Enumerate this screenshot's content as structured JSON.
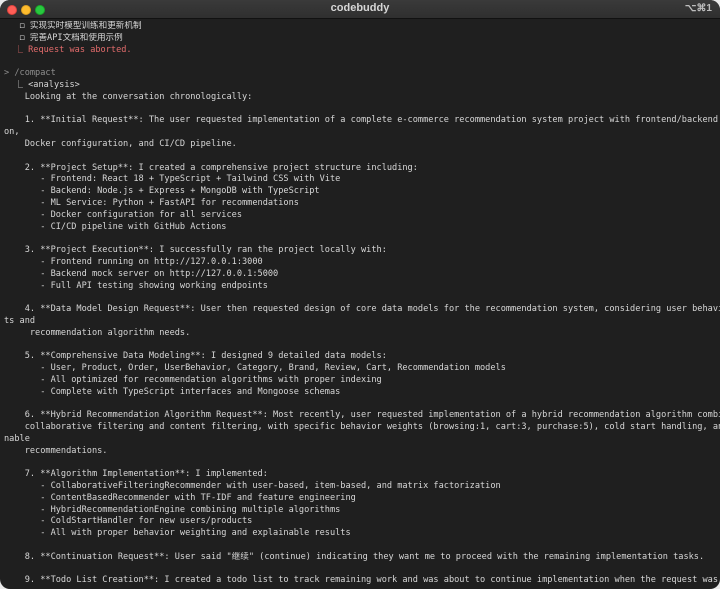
{
  "window": {
    "title": "codebuddy",
    "shortcut": "⌥⌘1"
  },
  "lines": [
    {
      "text": "   ◻ 实现实时模型训练和更新机制",
      "cls": ""
    },
    {
      "text": "   ◻ 完善API文档和使用示例",
      "cls": ""
    },
    {
      "text": "  ⎿ Request was aborted.",
      "cls": "err"
    },
    {
      "text": "",
      "cls": ""
    },
    {
      "text": "> /compact",
      "cls": "dim"
    },
    {
      "text": "  ⎿ <analysis>",
      "cls": ""
    },
    {
      "text": "    Looking at the conversation chronologically:",
      "cls": ""
    },
    {
      "text": "",
      "cls": ""
    },
    {
      "text": "    1. **Initial Request**: The user requested implementation of a complete e-commerce recommendation system project with frontend/backend separati",
      "cls": ""
    },
    {
      "text": "on,",
      "cls": ""
    },
    {
      "text": "    Docker configuration, and CI/CD pipeline.",
      "cls": ""
    },
    {
      "text": "",
      "cls": ""
    },
    {
      "text": "    2. **Project Setup**: I created a comprehensive project structure including:",
      "cls": ""
    },
    {
      "text": "       - Frontend: React 18 + TypeScript + Tailwind CSS with Vite",
      "cls": ""
    },
    {
      "text": "       - Backend: Node.js + Express + MongoDB with TypeScript",
      "cls": ""
    },
    {
      "text": "       - ML Service: Python + FastAPI for recommendations",
      "cls": ""
    },
    {
      "text": "       - Docker configuration for all services",
      "cls": ""
    },
    {
      "text": "       - CI/CD pipeline with GitHub Actions",
      "cls": ""
    },
    {
      "text": "",
      "cls": ""
    },
    {
      "text": "    3. **Project Execution**: I successfully ran the project locally with:",
      "cls": ""
    },
    {
      "text": "       - Frontend running on http://127.0.0.1:3000",
      "cls": ""
    },
    {
      "text": "       - Backend mock server on http://127.0.0.1:5000",
      "cls": ""
    },
    {
      "text": "       - Full API testing showing working endpoints",
      "cls": ""
    },
    {
      "text": "",
      "cls": ""
    },
    {
      "text": "    4. **Data Model Design Request**: User then requested design of core data models for the recommendation system, considering user behavior weigh",
      "cls": ""
    },
    {
      "text": "ts and",
      "cls": ""
    },
    {
      "text": "     recommendation algorithm needs.",
      "cls": ""
    },
    {
      "text": "",
      "cls": ""
    },
    {
      "text": "    5. **Comprehensive Data Modeling**: I designed 9 detailed data models:",
      "cls": ""
    },
    {
      "text": "       - User, Product, Order, UserBehavior, Category, Brand, Review, Cart, Recommendation models",
      "cls": ""
    },
    {
      "text": "       - All optimized for recommendation algorithms with proper indexing",
      "cls": ""
    },
    {
      "text": "       - Complete with TypeScript interfaces and Mongoose schemas",
      "cls": ""
    },
    {
      "text": "",
      "cls": ""
    },
    {
      "text": "    6. **Hybrid Recommendation Algorithm Request**: Most recently, user requested implementation of a hybrid recommendation algorithm combining",
      "cls": ""
    },
    {
      "text": "    collaborative filtering and content filtering, with specific behavior weights (browsing:1, cart:3, purchase:5), cold start handling, and explai",
      "cls": ""
    },
    {
      "text": "nable",
      "cls": ""
    },
    {
      "text": "    recommendations.",
      "cls": ""
    },
    {
      "text": "",
      "cls": ""
    },
    {
      "text": "    7. **Algorithm Implementation**: I implemented:",
      "cls": ""
    },
    {
      "text": "       - CollaborativeFilteringRecommender with user-based, item-based, and matrix factorization",
      "cls": ""
    },
    {
      "text": "       - ContentBasedRecommender with TF-IDF and feature engineering",
      "cls": ""
    },
    {
      "text": "       - HybridRecommendationEngine combining multiple algorithms",
      "cls": ""
    },
    {
      "text": "       - ColdStartHandler for new users/products",
      "cls": ""
    },
    {
      "text": "       - All with proper behavior weighting and explainable results",
      "cls": ""
    },
    {
      "text": "",
      "cls": ""
    },
    {
      "text": "    8. **Continuation Request**: User said \"继续\" (continue) indicating they want me to proceed with the remaining implementation tasks.",
      "cls": ""
    },
    {
      "text": "",
      "cls": ""
    },
    {
      "text": "    9. **Todo List Creation**: I created a todo list to track remaining work and was about to continue implementation when the request was aborted.",
      "cls": ""
    }
  ]
}
